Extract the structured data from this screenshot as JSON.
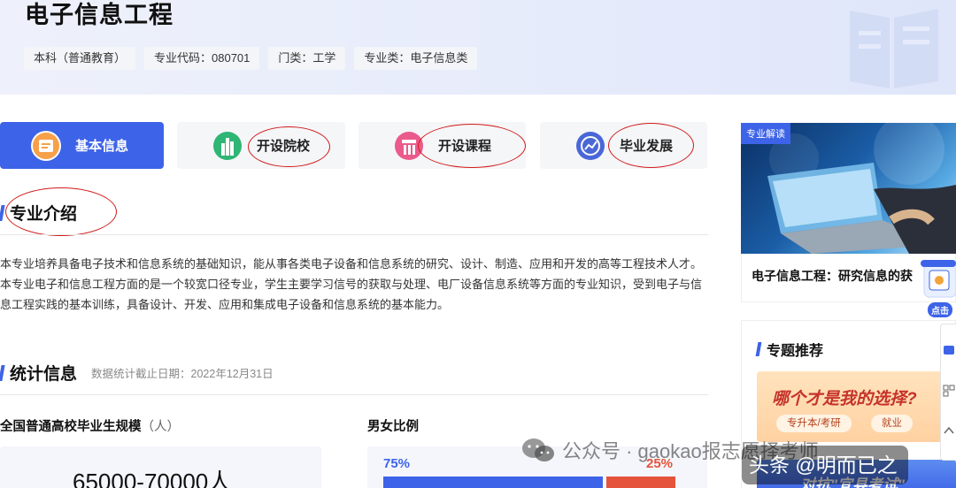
{
  "header": {
    "title": "电子信息工程",
    "tags": [
      "本科（普通教育）",
      "专业代码：080701",
      "门类：工学",
      "专业类：电子信息类"
    ]
  },
  "tabs": [
    {
      "label": "基本信息",
      "icon": "info-icon",
      "active": true
    },
    {
      "label": "开设院校",
      "icon": "school-building-icon",
      "active": false
    },
    {
      "label": "开设课程",
      "icon": "course-icon",
      "active": false
    },
    {
      "label": "毕业发展",
      "icon": "growth-chart-icon",
      "active": false
    }
  ],
  "intro": {
    "title": "专业介绍",
    "paragraphs": [
      "本专业培养具备电子技术和信息系统的基础知识，能从事各类电子设备和信息系统的研究、设计、制造、应用和开发的高等工程技术人才。",
      "本专业电子和信息工程方面的是一个较宽口径专业，学生主要学习信号的获取与处理、电厂设备信息系统等方面的专业知识，受到电子与信息工程实践的基本训练，具备设计、开发、应用和集成电子设备和信息系统的基本能力。"
    ]
  },
  "stats": {
    "title": "统计信息",
    "note": "数据统计截止日期：2022年12月31日",
    "graduates_label": "全国普通高校毕业生规模",
    "graduates_unit": "（人）",
    "graduates_value": "65000-70000人",
    "gender_label": "男女比例",
    "male_pct_text": "75%",
    "female_pct_text": "25%",
    "male_fraction": 0.75,
    "male_color": "#3d63e8",
    "female_color": "#e5533c"
  },
  "sidebar": {
    "card_tag": "专业解读",
    "card_caption": "电子信息工程：研究信息的获",
    "rec_title": "专题推荐",
    "rec_banner_title": "哪个才是我的选择?",
    "rec_chip_1": "专升本/考研",
    "rec_chip_2": "就业",
    "rec_banner2_title": "对抗\"宜县考试\"",
    "promo_label": "点击"
  },
  "watermark": {
    "wechat": "公众号 · gaokao报志愿择考师",
    "toutiao": "头条 @明而已之"
  },
  "colors": {
    "accent": "#3d63e8",
    "annotation_circle": "#d11a1a"
  }
}
